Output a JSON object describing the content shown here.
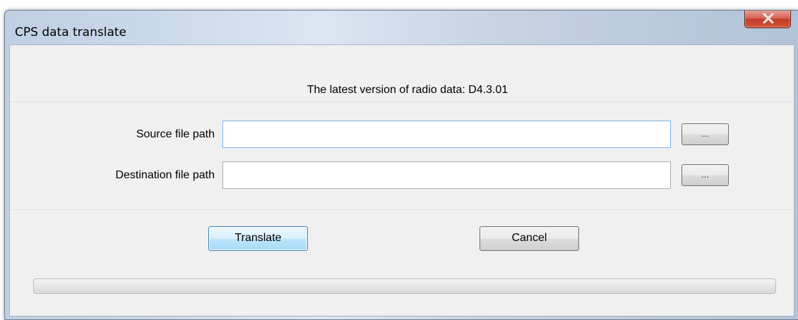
{
  "window": {
    "title": "CPS data translate"
  },
  "version": {
    "text": "The latest version of radio data: D4.3.01"
  },
  "source": {
    "label": "Source file path",
    "value": "",
    "browse_label": "..."
  },
  "destination": {
    "label": "Destination file path",
    "value": "",
    "browse_label": "..."
  },
  "buttons": {
    "translate": "Translate",
    "cancel": "Cancel"
  },
  "progress": {
    "fraction": 0
  },
  "icons": {
    "close": "close-icon"
  },
  "colors": {
    "close_button": "#c23b26",
    "default_button_border": "#3c7fb1"
  }
}
